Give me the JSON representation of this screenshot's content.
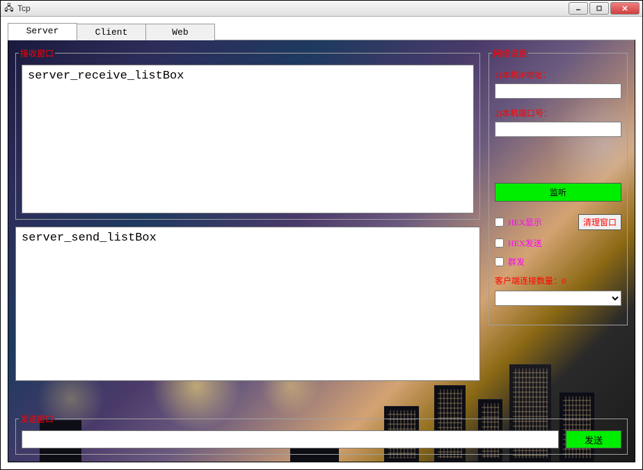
{
  "window": {
    "title": "Tcp"
  },
  "tabs": {
    "server": "Server",
    "client": "Client",
    "web": "Web"
  },
  "receive_panel": {
    "legend": "接收窗口",
    "content": "server_receive_listBox"
  },
  "send_list": {
    "content": "server_send_listBox"
  },
  "network": {
    "legend": "网络设置",
    "ip_label": "1)本机IP地址：",
    "ip_value": "",
    "port_label": "2)本机端口号：",
    "port_value": "",
    "listen_btn": "监听",
    "hex_show": "HEX显示",
    "clear_btn": "清理窗口",
    "hex_send": "HEX发送",
    "group_send": "群发",
    "conn_count_label": "客户端连接数量：0",
    "combo_value": ""
  },
  "send_panel": {
    "legend": "发送窗口",
    "input_value": "",
    "send_btn": "发送"
  }
}
